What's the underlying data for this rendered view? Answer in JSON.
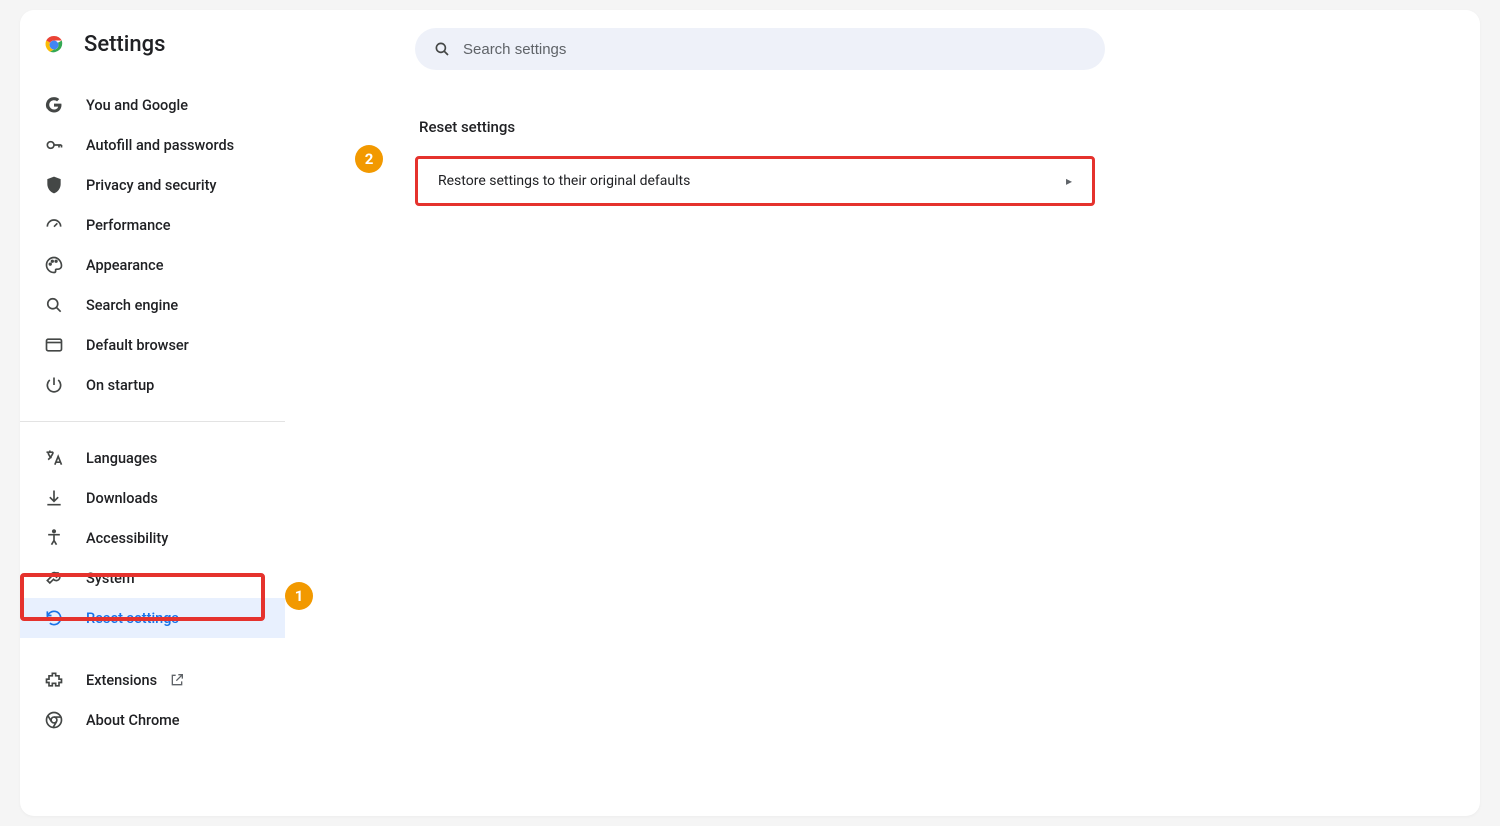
{
  "header": {
    "title": "Settings"
  },
  "search": {
    "placeholder": "Search settings"
  },
  "sidebar": {
    "items": [
      {
        "label": "You and Google"
      },
      {
        "label": "Autofill and passwords"
      },
      {
        "label": "Privacy and security"
      },
      {
        "label": "Performance"
      },
      {
        "label": "Appearance"
      },
      {
        "label": "Search engine"
      },
      {
        "label": "Default browser"
      },
      {
        "label": "On startup"
      }
    ],
    "items2": [
      {
        "label": "Languages"
      },
      {
        "label": "Downloads"
      },
      {
        "label": "Accessibility"
      },
      {
        "label": "System"
      },
      {
        "label": "Reset settings"
      }
    ],
    "items3": [
      {
        "label": "Extensions"
      },
      {
        "label": "About Chrome"
      }
    ]
  },
  "main": {
    "section_title": "Reset settings",
    "reset_row": "Restore settings to their original defaults"
  },
  "annotations": {
    "n1": "1",
    "n2": "2"
  }
}
